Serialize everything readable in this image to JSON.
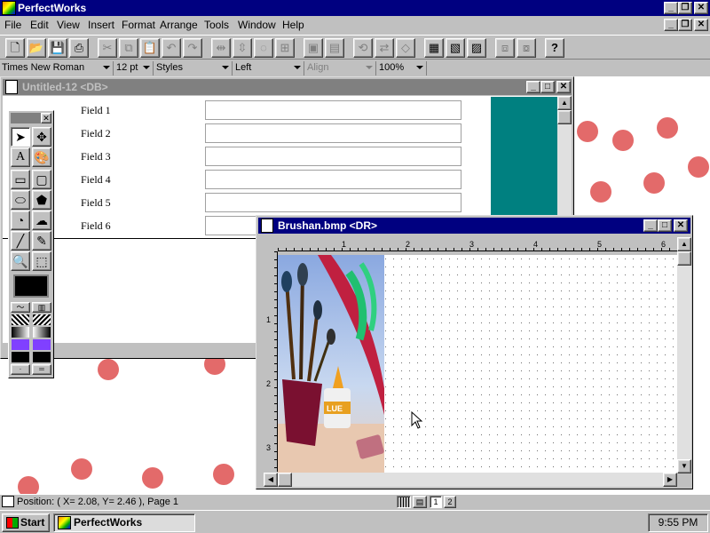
{
  "app": {
    "title": "PerfectWorks"
  },
  "menu": [
    "File",
    "Edit",
    "View",
    "Insert",
    "Format",
    "Arrange",
    "Tools",
    "Window",
    "Help"
  ],
  "toolbar": {
    "icons": [
      "new-document-icon",
      "open-folder-icon",
      "save-icon",
      "print-icon",
      "cut-icon",
      "copy-icon",
      "paste-icon",
      "undo-icon",
      "redo-icon",
      "align-left-icon",
      "align-center-icon",
      "align-right-icon",
      "distribute-icon",
      "group-icon",
      "ungroup-icon",
      "rotate-icon",
      "flip-icon",
      "reshape-icon",
      "draw-view-icon",
      "chart-view-icon",
      "table-view-icon",
      "bring-front-icon",
      "send-back-icon",
      "help-icon"
    ]
  },
  "format_bar": {
    "font": "Times New Roman",
    "size": "12 pt",
    "styles": "Styles",
    "justify": "Left",
    "align": "Align",
    "zoom": "100%"
  },
  "db_window": {
    "title": "Untitled-12 <DB>",
    "fields": [
      "Field 1",
      "Field 2",
      "Field 3",
      "Field 4",
      "Field 5",
      "Field 6"
    ],
    "accent": "#008080"
  },
  "bmp_window": {
    "title": "Brushan.bmp <DR>",
    "hruler": [
      "1",
      "2",
      "3",
      "4",
      "5",
      "6"
    ],
    "vruler": [
      "1",
      "2",
      "3"
    ]
  },
  "status": {
    "position": "Position: ( X= 2.08, Y= 2.46 ), Page 1"
  },
  "taskbar": {
    "start": "Start",
    "task": "PerfectWorks",
    "clock": "9:55 PM"
  }
}
